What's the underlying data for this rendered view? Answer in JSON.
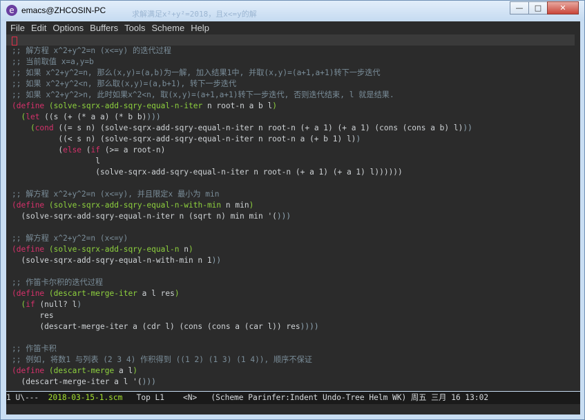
{
  "window": {
    "title": "emacs@ZHCOSIN-PC",
    "ghost_title": "求解满足x²+y²=2018，且x<=y的解"
  },
  "window_controls": {
    "minimize": "—",
    "maximize": "□",
    "close": "✕"
  },
  "menubar": [
    "File",
    "Edit",
    "Options",
    "Buffers",
    "Tools",
    "Scheme",
    "Help"
  ],
  "editor": {
    "lines": [
      [],
      [
        {
          "t": ";; 解方程 x^2+y^2=n (x<=y) 的迭代过程",
          "c": "c"
        }
      ],
      [
        {
          "t": ";; 当前取值 x=a,y=b",
          "c": "c"
        }
      ],
      [
        {
          "t": ";; 如果 x^2+y^2=n, 那么(x,y)=(a,b)为一解, 加入结果1中, 并取(x,y)=(a+1,a+1)转下一步迭代",
          "c": "c"
        }
      ],
      [
        {
          "t": ";; 如果 x^2+y^2<n, 那么取(x,y)=(a,b+1), 转下一步迭代",
          "c": "c"
        }
      ],
      [
        {
          "t": ";; 如果 x^2+y^2>n, 此时如果x^2<n, 取(x,y)=(a+1,a+1)转下一步迭代, 否则迭代结束, l 就是结果.",
          "c": "c"
        }
      ],
      [
        {
          "t": "(",
          "c": "kw"
        },
        {
          "t": "define",
          "c": "kw"
        },
        {
          "t": " ",
          "c": "df"
        },
        {
          "t": "(",
          "c": "fn"
        },
        {
          "t": "solve-sqrx-add-sqry-equal-n-iter",
          "c": "fn"
        },
        {
          "t": " n root-n a b l",
          "c": "df"
        },
        {
          "t": ")",
          "c": "fn"
        }
      ],
      [
        {
          "t": "  (",
          "c": "fn"
        },
        {
          "t": "let",
          "c": "kw"
        },
        {
          "t": " ((s (+ (* a a) (* b b)",
          "c": "df"
        },
        {
          "t": ")))",
          "c": "p"
        }
      ],
      [
        {
          "t": "    (",
          "c": "fn"
        },
        {
          "t": "cond",
          "c": "kw"
        },
        {
          "t": " ((= s n) (solve-sqrx-add-sqry-equal-n-iter n root-n (+ a 1) (+ a 1) (cons (cons a b) l)",
          "c": "df"
        },
        {
          "t": "))",
          "c": "p"
        }
      ],
      [
        {
          "t": "          ((< s n) (solve-sqrx-add-sqry-equal-n-iter n root-n a (+ b 1) l)",
          "c": "df"
        },
        {
          "t": ")",
          "c": "p"
        }
      ],
      [
        {
          "t": "          (",
          "c": "df"
        },
        {
          "t": "else",
          "c": "kw"
        },
        {
          "t": " (",
          "c": "df"
        },
        {
          "t": "if",
          "c": "kw"
        },
        {
          "t": " (>= a root-n)",
          "c": "df"
        }
      ],
      [
        {
          "t": "                  l",
          "c": "df"
        }
      ],
      [
        {
          "t": "                  (solve-sqrx-add-sqry-equal-n-iter n root-n (+ a 1) (+ a 1) l))))))",
          "c": "df"
        }
      ],
      [],
      [
        {
          "t": ";; 解方程 x^2+y^2=n (x<=y), 并且限定x 最小为 min",
          "c": "c"
        }
      ],
      [
        {
          "t": "(",
          "c": "kw"
        },
        {
          "t": "define",
          "c": "kw"
        },
        {
          "t": " ",
          "c": "df"
        },
        {
          "t": "(",
          "c": "fn"
        },
        {
          "t": "solve-sqrx-add-sqry-equal-n-with-min",
          "c": "fn"
        },
        {
          "t": " n min",
          "c": "df"
        },
        {
          "t": ")",
          "c": "fn"
        }
      ],
      [
        {
          "t": "  (solve-sqrx-add-sqry-equal-n-iter n (sqrt n) min min '(",
          "c": "df"
        },
        {
          "t": ")))",
          "c": "p"
        }
      ],
      [],
      [
        {
          "t": ";; 解方程 x^2+y^2=n (x<=y)",
          "c": "c"
        }
      ],
      [
        {
          "t": "(",
          "c": "kw"
        },
        {
          "t": "define",
          "c": "kw"
        },
        {
          "t": " ",
          "c": "df"
        },
        {
          "t": "(",
          "c": "fn"
        },
        {
          "t": "solve-sqrx-add-sqry-equal-n",
          "c": "fn"
        },
        {
          "t": " n",
          "c": "df"
        },
        {
          "t": ")",
          "c": "fn"
        }
      ],
      [
        {
          "t": "  (solve-sqrx-add-sqry-equal-n-with-min n 1",
          "c": "df"
        },
        {
          "t": "))",
          "c": "p"
        }
      ],
      [],
      [
        {
          "t": ";; 作笛卡尔积的迭代过程",
          "c": "c"
        }
      ],
      [
        {
          "t": "(",
          "c": "kw"
        },
        {
          "t": "define",
          "c": "kw"
        },
        {
          "t": " ",
          "c": "df"
        },
        {
          "t": "(",
          "c": "fn"
        },
        {
          "t": "descart-merge-iter",
          "c": "fn"
        },
        {
          "t": " a l res",
          "c": "df"
        },
        {
          "t": ")",
          "c": "fn"
        }
      ],
      [
        {
          "t": "  (",
          "c": "fn"
        },
        {
          "t": "if",
          "c": "kw"
        },
        {
          "t": " (null? l",
          "c": "df"
        },
        {
          "t": ")",
          "c": "p"
        }
      ],
      [
        {
          "t": "      res",
          "c": "df"
        }
      ],
      [
        {
          "t": "      (descart-merge-iter a (cdr l) (cons (cons a (car l)) res",
          "c": "df"
        },
        {
          "t": "))))",
          "c": "p"
        }
      ],
      [],
      [
        {
          "t": ";; 作笛卡积",
          "c": "c"
        }
      ],
      [
        {
          "t": ";; 例如, 将数1 与列表 (2 3 4) 作积得到 ((1 2) (1 3) (1 4)), 顺序不保证",
          "c": "c"
        }
      ],
      [
        {
          "t": "(",
          "c": "kw"
        },
        {
          "t": "define",
          "c": "kw"
        },
        {
          "t": " ",
          "c": "df"
        },
        {
          "t": "(",
          "c": "fn"
        },
        {
          "t": "descart-merge",
          "c": "fn"
        },
        {
          "t": " a l",
          "c": "df"
        },
        {
          "t": ")",
          "c": "fn"
        }
      ],
      [
        {
          "t": "  (descart-merge-iter a l '(",
          "c": "df"
        },
        {
          "t": ")))",
          "c": "p"
        }
      ]
    ]
  },
  "modeline": {
    "prefix": "1 U\\---  ",
    "filename": "2018-03-15-1.scm",
    "rest": "   Top L1    <N>   (Scheme Parinfer:Indent Undo-Tree Helm WK) 周五 三月 16 13:02"
  }
}
